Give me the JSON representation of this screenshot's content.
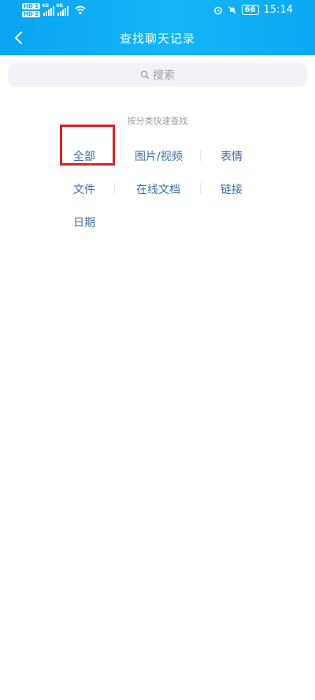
{
  "status_bar": {
    "hd1": "HD 1",
    "hd2": "HD 2",
    "sig1_tag": "4G",
    "sig2_tag": "4G",
    "battery": "66",
    "time": "15:14"
  },
  "nav": {
    "title": "查找聊天记录"
  },
  "search": {
    "label": "搜索"
  },
  "categories": {
    "hint": "按分类快速查找",
    "items": [
      {
        "label": "全部"
      },
      {
        "label": "图片/视频"
      },
      {
        "label": "表情"
      },
      {
        "label": "文件"
      },
      {
        "label": "在线文档"
      },
      {
        "label": "链接"
      },
      {
        "label": "日期"
      }
    ]
  },
  "colors": {
    "header": "#0aa9f4",
    "category_text": "#3d6ea7",
    "highlight_box": "#d5252a"
  }
}
